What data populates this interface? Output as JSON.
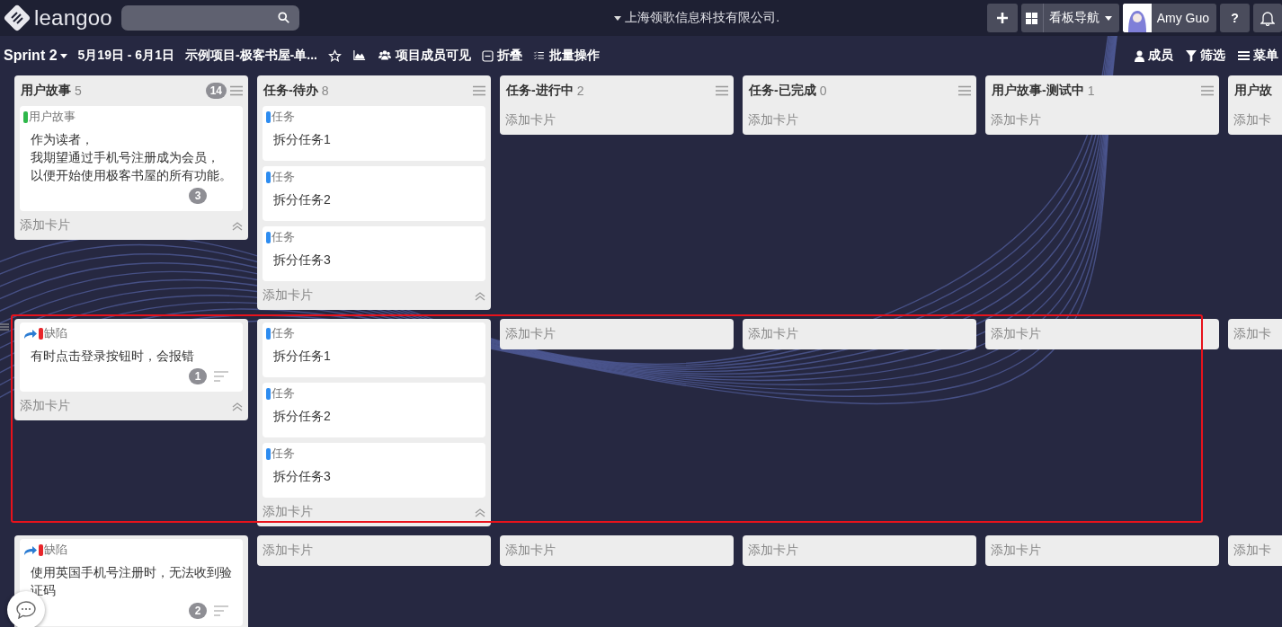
{
  "header": {
    "logo": "leangoo",
    "company": "上海领歌信息科技有限公司.",
    "board_nav": "看板导航",
    "user": "Amy Guo",
    "help": "?"
  },
  "toolbar": {
    "sprint": "Sprint 2",
    "dates": "5月19日 - 6月1日",
    "project": "示例项目-极客书屋-单...",
    "left_items": [
      {
        "kind": "star"
      },
      {
        "kind": "chart"
      },
      {
        "kind": "members",
        "label": "项目成员可见"
      },
      {
        "kind": "fold",
        "label": "折叠"
      },
      {
        "kind": "batch",
        "label": "批量操作"
      }
    ],
    "right_items": [
      {
        "kind": "person",
        "label": "成员"
      },
      {
        "kind": "filter",
        "label": "筛选"
      },
      {
        "kind": "menu",
        "label": "菜单"
      }
    ]
  },
  "columns": [
    {
      "title": "用户故事",
      "count": "5",
      "badge": "14"
    },
    {
      "title": "任务-待办",
      "count": "8"
    },
    {
      "title": "任务-进行中",
      "count": "2"
    },
    {
      "title": "任务-已完成",
      "count": "0"
    },
    {
      "title": "用户故事-测试中",
      "count": "1"
    },
    {
      "title": "用户故"
    }
  ],
  "lanes": [
    {
      "highlighted": false,
      "drag_handle": false,
      "cells": [
        {
          "cards": [
            {
              "tag": "用户故事",
              "color": "#2eb84a",
              "linked": false,
              "lines": [
                "作为读者，",
                "我期望通过手机号注册成为会员，",
                "以便开始使用极客书屋的所有功能。"
              ],
              "badge": "3",
              "has_description": false
            }
          ],
          "add": "添加卡片",
          "collapse": true
        },
        {
          "cards": [
            {
              "tag": "任务",
              "color": "#2d8cf0",
              "linked": false,
              "lines": [
                "拆分任务1"
              ]
            },
            {
              "tag": "任务",
              "color": "#2d8cf0",
              "linked": false,
              "lines": [
                "拆分任务2"
              ]
            },
            {
              "tag": "任务",
              "color": "#2d8cf0",
              "linked": false,
              "lines": [
                "拆分任务3"
              ]
            }
          ],
          "add": "添加卡片",
          "collapse": true
        },
        {
          "add": "添加卡片",
          "collapse": false
        },
        {
          "add": "添加卡片",
          "collapse": false
        },
        {
          "add": "添加卡片",
          "collapse": false
        },
        {
          "add": "添加卡",
          "collapse": false
        }
      ]
    },
    {
      "highlighted": true,
      "drag_handle": true,
      "cells": [
        {
          "cards": [
            {
              "tag": "缺陷",
              "color": "#e8262b",
              "linked": true,
              "lines": [
                "有时点击登录按钮时，会报错"
              ],
              "badge": "1",
              "has_description": true
            }
          ],
          "add": "添加卡片",
          "collapse": true
        },
        {
          "cards": [
            {
              "tag": "任务",
              "color": "#2d8cf0",
              "linked": false,
              "lines": [
                "拆分任务1"
              ]
            },
            {
              "tag": "任务",
              "color": "#2d8cf0",
              "linked": false,
              "lines": [
                "拆分任务2"
              ]
            },
            {
              "tag": "任务",
              "color": "#2d8cf0",
              "linked": false,
              "lines": [
                "拆分任务3"
              ]
            }
          ],
          "add": "添加卡片",
          "collapse": true
        },
        {
          "add": "添加卡片",
          "collapse": false
        },
        {
          "add": "添加卡片",
          "collapse": false
        },
        {
          "add": "添加卡片",
          "collapse": false
        },
        {
          "add": "添加卡",
          "collapse": false
        }
      ]
    },
    {
      "highlighted": false,
      "drag_handle": false,
      "cells": [
        {
          "cards": [
            {
              "tag": "缺陷",
              "color": "#e8262b",
              "linked": true,
              "lines": [
                "使用英国手机号注册时，无法收到验证码"
              ],
              "badge": "2",
              "has_description": true
            }
          ]
        },
        {
          "add": "添加卡片",
          "collapse": false
        },
        {
          "add": "添加卡片",
          "collapse": false
        },
        {
          "add": "添加卡片",
          "collapse": false
        },
        {
          "add": "添加卡片",
          "collapse": false
        },
        {
          "add": "添加卡",
          "collapse": false
        }
      ]
    }
  ]
}
